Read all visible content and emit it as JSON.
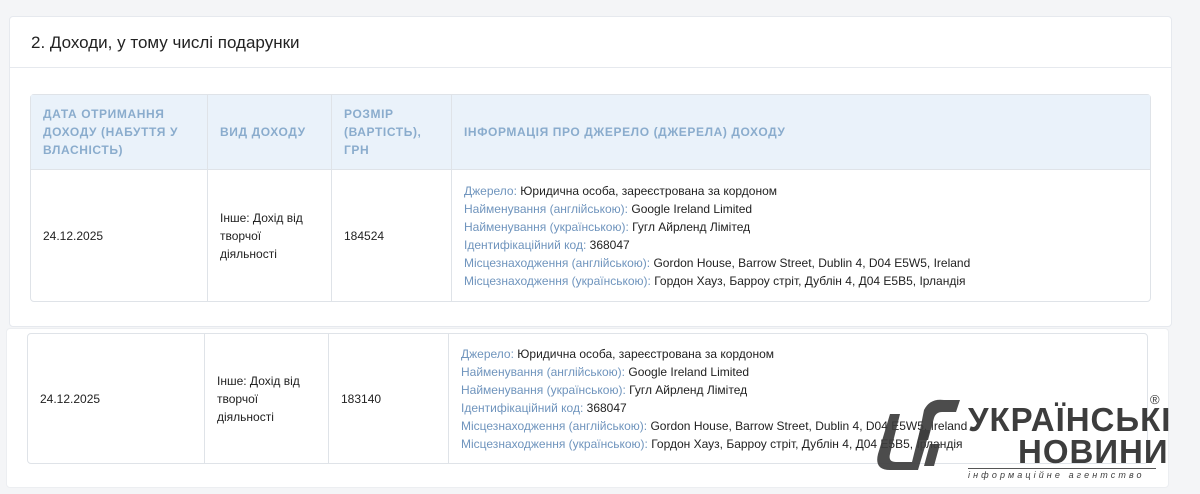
{
  "section": {
    "title": "2. Доходи, у тому числі подарунки"
  },
  "table": {
    "headers": [
      "ДАТА ОТРИМАННЯ ДОХОДУ (НАБУТТЯ У ВЛАСНІСТЬ)",
      "ВИД ДОХОДУ",
      "РОЗМІР (ВАРТІСТЬ), ГРН",
      "ІНФОРМАЦІЯ ПРО ДЖЕРЕЛО (ДЖЕРЕЛА) ДОХОДУ"
    ],
    "rows": [
      {
        "date": "24.12.2025",
        "type": "Інше: Дохід від творчої діяльності",
        "amount": "184524",
        "info": [
          {
            "k": "Джерело:",
            "v": "Юридична особа, зареєстрована за кордоном"
          },
          {
            "k": "Найменування (англійською):",
            "v": "Google Ireland Limited"
          },
          {
            "k": "Найменування (українською):",
            "v": "Гугл Айрленд Лімітед"
          },
          {
            "k": "Ідентифікаційний код:",
            "v": "368047"
          },
          {
            "k": "Місцезнаходження (англійською):",
            "v": "Gordon House, Barrow Street, Dublin 4, D04 E5W5, Ireland"
          },
          {
            "k": "Місцезнаходження (українською):",
            "v": "Гордон Хауз, Барроу стріт, Дублін 4, Д04 Е5В5, Ірландія"
          }
        ]
      },
      {
        "date": "24.12.2025",
        "type": "Інше: Дохід від творчої діяльності",
        "amount": "183140",
        "info": [
          {
            "k": "Джерело:",
            "v": "Юридична особа, зареєстрована за кордоном"
          },
          {
            "k": "Найменування (англійською):",
            "v": "Google Ireland Limited"
          },
          {
            "k": "Найменування (українською):",
            "v": "Гугл Айрленд Лімітед"
          },
          {
            "k": "Ідентифікаційний код:",
            "v": "368047"
          },
          {
            "k": "Місцезнаходження (англійською):",
            "v": "Gordon House, Barrow Street, Dublin 4, D04 E5W5, Ireland"
          },
          {
            "k": "Місцезнаходження (українською):",
            "v": "Гордон Хауз, Барроу стріт, Дублін 4, Д04 Е5В5, Ірландія"
          }
        ]
      }
    ]
  },
  "logo": {
    "word1": "УКРАЇНСЬКІ",
    "word2": "НОВИНИ",
    "sub": "інформаційне агентство",
    "reg": "®"
  }
}
